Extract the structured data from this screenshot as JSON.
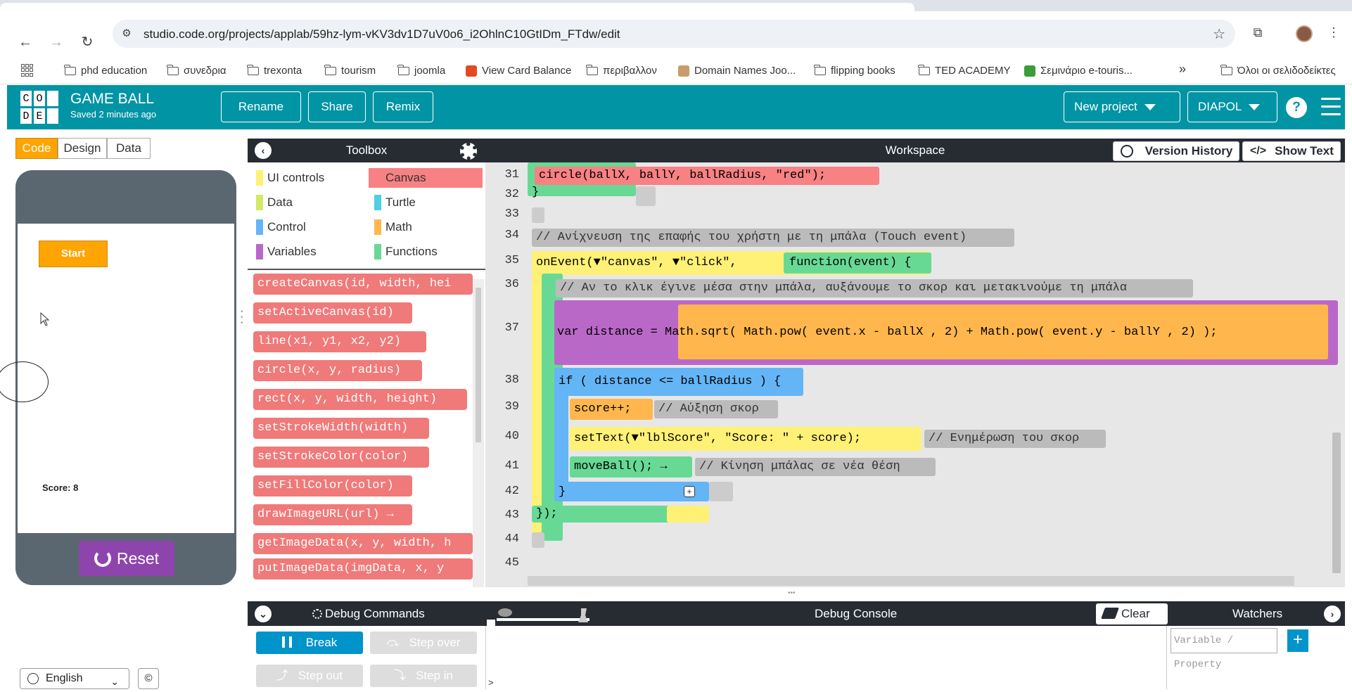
{
  "browser": {
    "url": "studio.code.org/projects/applab/59hz-lym-vKV3dv1D7uV0o6_i2OhlnC10GtIDm_FTdw/edit",
    "bookmarks": [
      "phd education",
      "συνεδρια",
      "trexonta",
      "tourism",
      "joomla",
      "View Card Balance",
      "περιβαλλον",
      "Domain Names Joo...",
      "flipping books",
      "TED ACADEMY",
      "Σεμινάριο e-touris..."
    ],
    "overflow": "»",
    "all_bookmarks": "Όλοι οι σελιδοδείκτες"
  },
  "header": {
    "logo_letters": [
      "C",
      "O",
      "D",
      "D",
      "E",
      ""
    ],
    "project_name": "GAME BALL",
    "saved": "Saved 2 minutes ago",
    "buttons": {
      "rename": "Rename",
      "share": "Share",
      "remix": "Remix"
    },
    "new_project": "New project",
    "user": "DIAPOL",
    "help": "?"
  },
  "mode_tabs": {
    "code": "Code",
    "design": "Design",
    "data": "Data"
  },
  "app_preview": {
    "start": "Start",
    "score": "Score: 8",
    "reset": "Reset"
  },
  "footer": {
    "language": "English",
    "cc": "©"
  },
  "toolbox": {
    "title": "Toolbox",
    "categories": [
      {
        "label": "UI controls",
        "color": "#fff176"
      },
      {
        "label": "Canvas",
        "color": "#f78183"
      },
      {
        "label": "Data",
        "color": "#d3e965"
      },
      {
        "label": "Turtle",
        "color": "#4dd0e1"
      },
      {
        "label": "Control",
        "color": "#64b5f6"
      },
      {
        "label": "Math",
        "color": "#ffb74d"
      },
      {
        "label": "Variables",
        "color": "#ba68c8"
      },
      {
        "label": "Functions",
        "color": "#68d995"
      }
    ],
    "blocks": [
      "createCanvas(id, width, hei",
      "setActiveCanvas(id)",
      "line(x1, y1, x2, y2)",
      "circle(x, y, radius)",
      "rect(x, y, width, height)",
      "setStrokeWidth(width)",
      "setStrokeColor(color)",
      "setFillColor(color)",
      "drawImageURL(url) →",
      "getImageData(x, y, width, h",
      "putImageData(imgData, x, y"
    ]
  },
  "workspace": {
    "title": "Workspace",
    "version_history": "Version History",
    "show_text": "Show Text",
    "line_numbers": [
      "31",
      "32",
      "33",
      "34",
      "35",
      "36",
      "37",
      "38",
      "39",
      "40",
      "41",
      "42",
      "43",
      "44",
      "45"
    ],
    "code": {
      "l31": "circle(ballX, ballY, ballRadius, \"red\");",
      "l32": "}",
      "l34": "// Ανίχνευση της επαφής του χρήστη με τη μπάλα (Touch event)",
      "l35a": "onEvent(▼\"canvas\", ▼\"click\",",
      "l35b": "function(event) {",
      "l36": "// Αν το κλικ έγινε μέσα στην μπάλα, αυξάνουμε το σκορ και μετακινούμε τη μπάλα",
      "l37": "var distance = Math.sqrt( Math.pow( event.x - ballX , 2) + Math.pow( event.y - ballY , 2) );",
      "l38": "if ( distance <= ballRadius ) {",
      "l39": "score++;",
      "l39c": "// Αύξηση σκορ",
      "l40": "setText(▼\"lblScore\", \"Score: \" + score);",
      "l40c": "// Ενημέρωση του σκορ",
      "l41": "moveBall(); →",
      "l41c": "// Κίνηση μπάλας σε νέα θέση",
      "l42": "}",
      "l43": "});"
    }
  },
  "debug": {
    "commands": "Debug Commands",
    "console": "Debug Console",
    "clear": "Clear",
    "watchers": "Watchers",
    "break": "Break",
    "step_over": "Step over",
    "step_out": "Step out",
    "step_in": "Step in",
    "watch_placeholder": "Variable / Property",
    "add": "+",
    "prompt": ">"
  }
}
